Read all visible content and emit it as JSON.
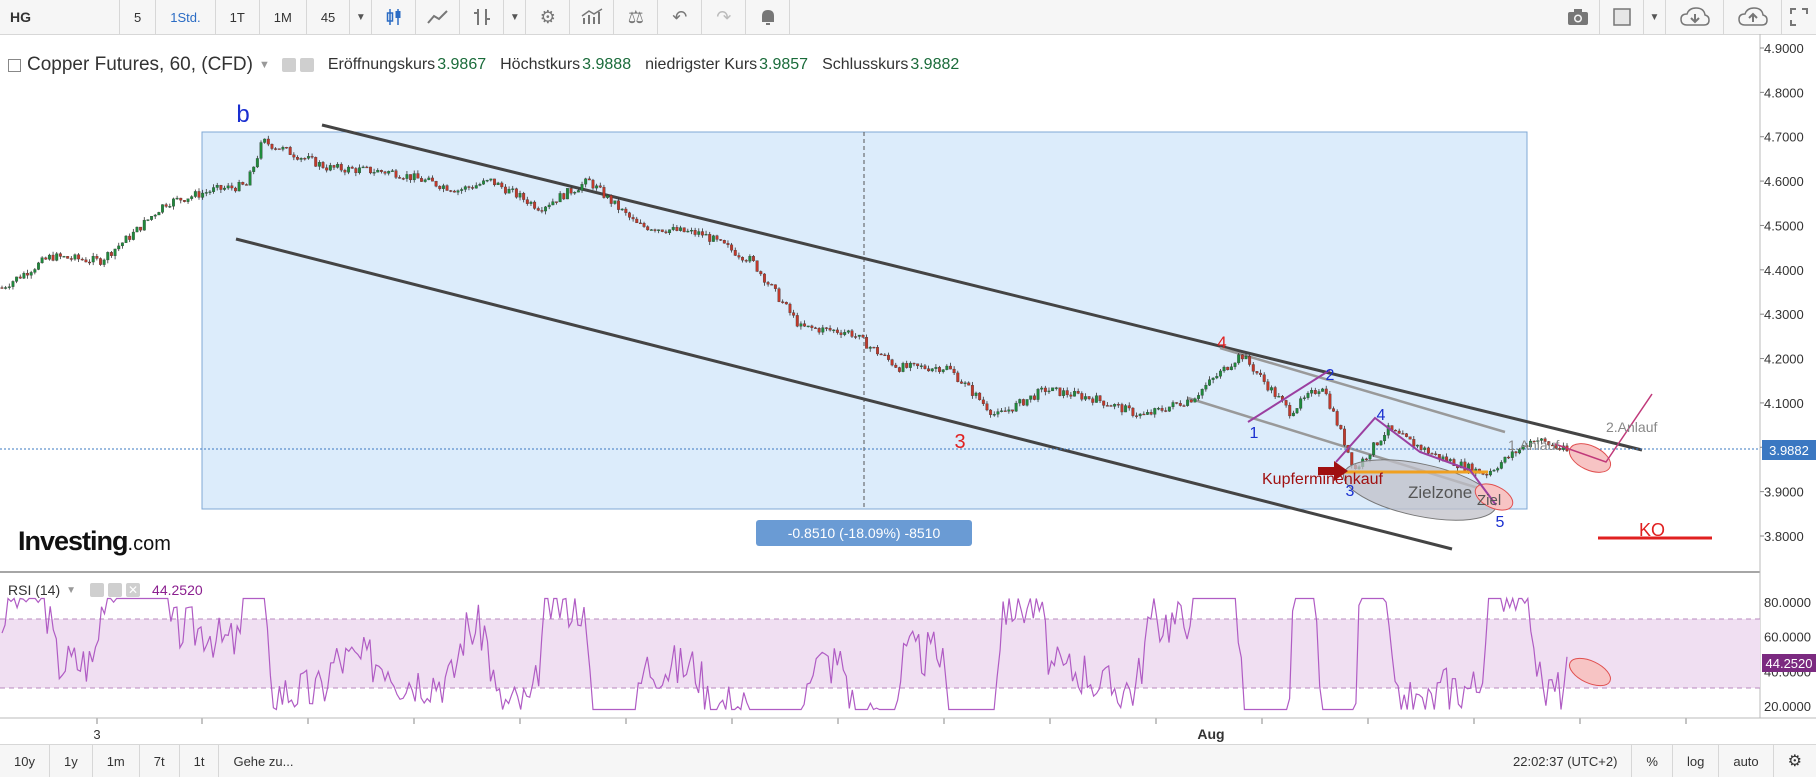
{
  "toolbar": {
    "symbol": "HG",
    "intervals": [
      "5",
      "1Std.",
      "1T",
      "1M",
      "45"
    ],
    "active_interval": "1Std."
  },
  "legend": {
    "title": "Copper Futures, 60, (CFD)",
    "open_label": "Eröffnungskurs",
    "open_value": "3.9867",
    "high_label": "Höchstkurs",
    "high_value": "3.9888",
    "low_label": "niedrigster Kurs",
    "low_value": "3.9857",
    "close_label": "Schlusskurs",
    "close_value": "3.9882"
  },
  "rsi": {
    "label": "RSI (14)",
    "value": "44.2520"
  },
  "logo": {
    "main": "Investing",
    "suffix": ".com"
  },
  "bottom_bar": {
    "ranges": [
      "10y",
      "1y",
      "1m",
      "7t",
      "1t"
    ],
    "goto": "Gehe zu...",
    "time": "22:02:37 (UTC+2)",
    "percent": "%",
    "log": "log",
    "auto": "auto"
  },
  "colors": {
    "up_candle": "#1f8a3c",
    "down_candle": "#c0392b",
    "measure_fill": "#dcecfb",
    "rsi_line": "#b05cc4",
    "rsi_band": "#f0dff2",
    "price_tag": "#3b78c2"
  },
  "chart_data": {
    "type": "candlestick",
    "symbol": "Copper Futures",
    "price_axis": {
      "ticks": [
        "4.9000",
        "4.8000",
        "4.7000",
        "4.6000",
        "4.5000",
        "4.4000",
        "4.3000",
        "4.2000",
        "4.1000",
        "4.0000",
        "3.9000",
        "3.8000"
      ],
      "current_price": "3.9882",
      "range": [
        3.75,
        4.9
      ]
    },
    "time_axis": {
      "labels": [
        "3",
        "Aug"
      ]
    },
    "price_path": [
      [
        0,
        4.36
      ],
      [
        0.03,
        4.43
      ],
      [
        0.06,
        4.42
      ],
      [
        0.08,
        4.48
      ],
      [
        0.1,
        4.55
      ],
      [
        0.13,
        4.58
      ],
      [
        0.15,
        4.59
      ],
      [
        0.16,
        4.69
      ],
      [
        0.2,
        4.63
      ],
      [
        0.24,
        4.62
      ],
      [
        0.28,
        4.58
      ],
      [
        0.3,
        4.6
      ],
      [
        0.33,
        4.54
      ],
      [
        0.36,
        4.6
      ],
      [
        0.39,
        4.5
      ],
      [
        0.43,
        4.48
      ],
      [
        0.46,
        4.42
      ],
      [
        0.49,
        4.27
      ],
      [
        0.52,
        4.26
      ],
      [
        0.55,
        4.18
      ],
      [
        0.58,
        4.18
      ],
      [
        0.61,
        4.07
      ],
      [
        0.64,
        4.13
      ],
      [
        0.67,
        4.11
      ],
      [
        0.7,
        4.07
      ],
      [
        0.73,
        4.11
      ],
      [
        0.76,
        4.21
      ],
      [
        0.79,
        4.08
      ],
      [
        0.81,
        4.14
      ],
      [
        0.83,
        3.95
      ],
      [
        0.85,
        4.04
      ],
      [
        0.88,
        3.98
      ],
      [
        0.91,
        3.94
      ],
      [
        0.94,
        4.02
      ],
      [
        0.96,
        3.99
      ]
    ],
    "measure": {
      "label": "-0.8510 (-18.09%) -8510",
      "top": 4.705,
      "bottom": 3.854
    },
    "annotations": {
      "wave_b": "b",
      "wave_3": "3",
      "wave_4": "4",
      "sub_waves": [
        "1",
        "2",
        "3",
        "4",
        "5"
      ],
      "kupfer_label": "Kupferminenkauf",
      "zielzone": "Zielzone",
      "ziel": "Ziel",
      "anlauf1": "1.Anlauf",
      "anlauf2": "2.Anlauf",
      "ko": "KO"
    },
    "rsi": {
      "ticks": [
        "80.0000",
        "60.0000",
        "40.0000",
        "20.0000"
      ],
      "upper_band": 70,
      "lower_band": 30,
      "current": "44.2520"
    }
  }
}
